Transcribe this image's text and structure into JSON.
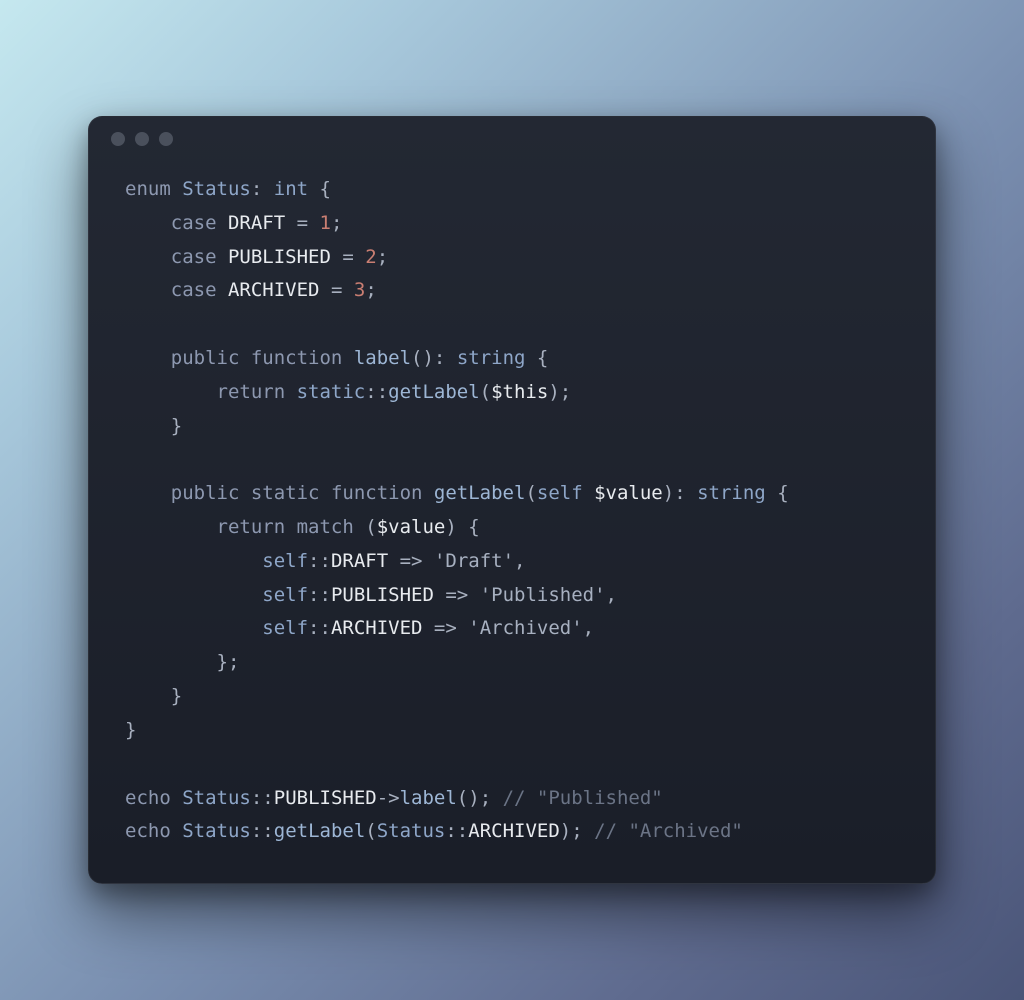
{
  "traffic_lights": [
    "dot",
    "dot",
    "dot"
  ],
  "code": {
    "l1": {
      "kw_enum": "enum",
      "sp": " ",
      "type_status": "Status",
      "colon": ": ",
      "type_int": "int",
      "sp2": " ",
      "brace": "{"
    },
    "l2": {
      "indent": "    ",
      "kw_case": "case",
      "sp": " ",
      "const": "DRAFT",
      "sp2": " ",
      "eq": "=",
      "sp3": " ",
      "num": "1",
      "semi": ";"
    },
    "l3": {
      "indent": "    ",
      "kw_case": "case",
      "sp": " ",
      "const": "PUBLISHED",
      "sp2": " ",
      "eq": "=",
      "sp3": " ",
      "num": "2",
      "semi": ";"
    },
    "l4": {
      "indent": "    ",
      "kw_case": "case",
      "sp": " ",
      "const": "ARCHIVED",
      "sp2": " ",
      "eq": "=",
      "sp3": " ",
      "num": "3",
      "semi": ";"
    },
    "l5": {
      "blank": ""
    },
    "l6": {
      "indent": "    ",
      "kw_public": "public",
      "sp": " ",
      "kw_function": "function",
      "sp2": " ",
      "fn": "label",
      "paren": "()",
      "colon": ": ",
      "type": "string",
      "sp3": " ",
      "brace": "{"
    },
    "l7": {
      "indent": "        ",
      "kw_return": "return",
      "sp": " ",
      "type_static": "static",
      "dcolon": "::",
      "fn": "getLabel",
      "paren_o": "(",
      "var": "$this",
      "paren_c": ")",
      "semi": ";"
    },
    "l8": {
      "indent": "    ",
      "brace": "}"
    },
    "l9": {
      "blank": ""
    },
    "l10": {
      "indent": "    ",
      "kw_public": "public",
      "sp": " ",
      "kw_static": "static",
      "sp2": " ",
      "kw_function": "function",
      "sp3": " ",
      "fn": "getLabel",
      "paren_o": "(",
      "type_self": "self",
      "sp4": " ",
      "var": "$value",
      "paren_c": ")",
      "colon": ": ",
      "type": "string",
      "sp5": " ",
      "brace": "{"
    },
    "l11": {
      "indent": "        ",
      "kw_return": "return",
      "sp": " ",
      "fn_match": "match",
      "sp2": " ",
      "paren_o": "(",
      "var": "$value",
      "paren_c": ")",
      "sp3": " ",
      "brace": "{"
    },
    "l12": {
      "indent": "            ",
      "type_self": "self",
      "dcolon": "::",
      "const": "DRAFT",
      "sp": " ",
      "arrow": "=>",
      "sp2": " ",
      "str": "'Draft'",
      "comma": ","
    },
    "l13": {
      "indent": "            ",
      "type_self": "self",
      "dcolon": "::",
      "const": "PUBLISHED",
      "sp": " ",
      "arrow": "=>",
      "sp2": " ",
      "str": "'Published'",
      "comma": ","
    },
    "l14": {
      "indent": "            ",
      "type_self": "self",
      "dcolon": "::",
      "const": "ARCHIVED",
      "sp": " ",
      "arrow": "=>",
      "sp2": " ",
      "str": "'Archived'",
      "comma": ","
    },
    "l15": {
      "indent": "        ",
      "brace": "}",
      "semi": ";"
    },
    "l16": {
      "indent": "    ",
      "brace": "}"
    },
    "l17": {
      "brace": "}"
    },
    "l18": {
      "blank": ""
    },
    "l19": {
      "kw_echo": "echo",
      "sp": " ",
      "type_status": "Status",
      "dcolon": "::",
      "const": "PUBLISHED",
      "arrow": "->",
      "fn": "label",
      "paren": "()",
      "semi": ";",
      "sp2": " ",
      "cmt": "// \"Published\""
    },
    "l20": {
      "kw_echo": "echo",
      "sp": " ",
      "type_status": "Status",
      "dcolon": "::",
      "fn": "getLabel",
      "paren_o": "(",
      "type_status2": "Status",
      "dcolon2": "::",
      "const": "ARCHIVED",
      "paren_c": ")",
      "semi": ";",
      "sp2": " ",
      "cmt": "// \"Archived\""
    }
  }
}
